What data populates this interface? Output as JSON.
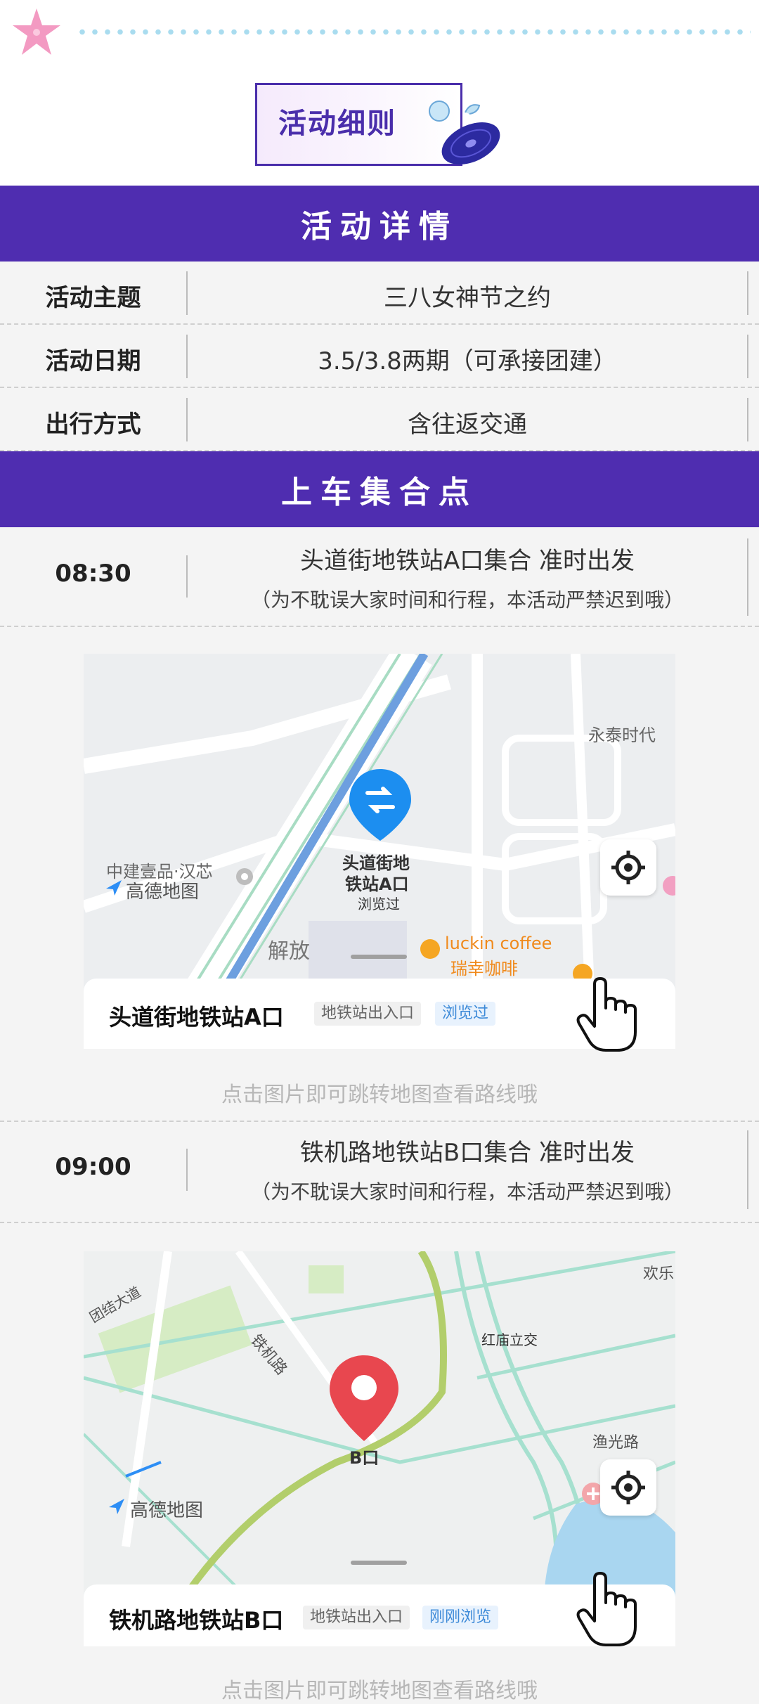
{
  "header": {
    "badge_title": "活动细则"
  },
  "details": {
    "section_title": "活动详情",
    "rows": [
      {
        "label": "活动主题",
        "value": "三八女神节之约"
      },
      {
        "label": "活动日期",
        "value": "3.5/3.8两期（可承接团建）"
      },
      {
        "label": "出行方式",
        "value": "含往返交通"
      }
    ]
  },
  "pickup": {
    "section_title": "上车集合点",
    "points": [
      {
        "time": "08:30",
        "title": "头道街地铁站A口集合 准时出发",
        "note": "（为不耽误大家时间和行程，本活动严禁迟到哦）",
        "map": {
          "pin_label_line1": "头道街地",
          "pin_label_line2": "铁站A口",
          "pin_label_line3": "浏览过",
          "labels": [
            "永泰时代",
            "中建壹品·汉芯",
            "luckin coffee",
            "瑞幸咖啡",
            "解放"
          ],
          "brand": "高德地图",
          "place_name": "头道街地铁站A口",
          "tag1": "地铁站出入口",
          "tag2": "浏览过"
        },
        "hint": "点击图片即可跳转地图查看路线哦"
      },
      {
        "time": "09:00",
        "title": "铁机路地铁站B口集合 准时出发",
        "note": "（为不耽误大家时间和行程，本活动严禁迟到哦）",
        "map": {
          "pin_label": "B口",
          "labels": [
            "红庙立交",
            "铁机路",
            "渔光路",
            "欢乐",
            "团结大道"
          ],
          "brand": "高德地图",
          "place_name": "铁机路地铁站B口",
          "tag1": "地铁站出入口",
          "tag2": "刚刚浏览"
        },
        "hint": "点击图片即可跳转地图查看路线哦"
      }
    ]
  },
  "colors": {
    "accent": "#4f2db0",
    "band_text": "#ffffff",
    "hint": "#b7b7b7"
  }
}
